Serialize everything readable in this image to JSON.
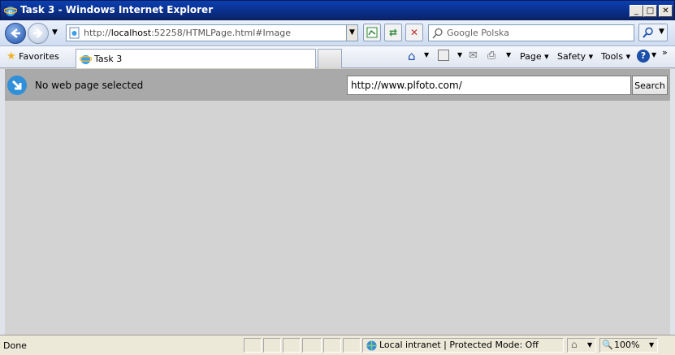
{
  "window": {
    "title": "Task 3 - Windows Internet Explorer",
    "minimize": "_",
    "maximize": "□",
    "close": "✕"
  },
  "address_bar": {
    "url_prefix": "http://",
    "url_host": "localhost",
    "url_rest": ":52258/HTMLPage.html#Image"
  },
  "search": {
    "placeholder": "Google Polska"
  },
  "favorites": {
    "label": "Favorites"
  },
  "tabs": [
    {
      "label": "Task 3"
    }
  ],
  "command_bar": {
    "page": "Page",
    "safety": "Safety",
    "tools": "Tools"
  },
  "app": {
    "status_text": "No web page selected",
    "url_value": "http://www.plfoto.com/",
    "search_button": "Search"
  },
  "statusbar": {
    "status": "Done",
    "zone": "Local intranet | Protected Mode: Off",
    "zoom": "100%"
  },
  "icons": {
    "back": "back-arrow-icon",
    "forward": "forward-arrow-icon",
    "refresh": "refresh-icon",
    "stop": "stop-icon",
    "home": "home-icon",
    "feeds": "rss-icon",
    "mail": "mail-icon",
    "print": "print-icon",
    "help": "help-icon"
  }
}
